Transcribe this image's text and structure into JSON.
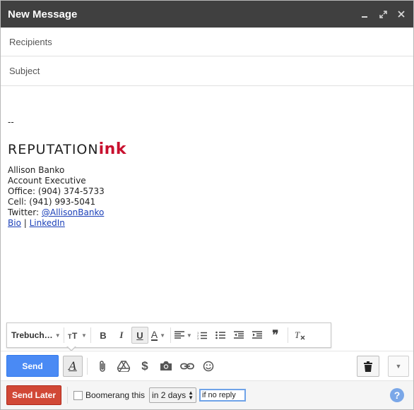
{
  "window": {
    "title": "New Message",
    "controls": {
      "minimize": "▁",
      "expand": "⤢",
      "close": "✕"
    }
  },
  "fields": {
    "recipients_placeholder": "Recipients",
    "subject_placeholder": "Subject"
  },
  "body": {
    "dashes": "--",
    "logo": {
      "part1": "REPUTATION",
      "part2": "ink"
    },
    "signature": {
      "name": "Allison Banko",
      "role": "Account Executive",
      "office": "Office: (904) 374-5733",
      "cell": "Cell: (941) 993-5041",
      "twitter_prefix": "Twitter: ",
      "twitter_handle": "@AllisonBanko",
      "bio_link": "Bio",
      "separator": " | ",
      "linkedin_link": "LinkedIn"
    }
  },
  "format_toolbar": {
    "font": "Trebuch…",
    "size_icon": "TT",
    "bold": "B",
    "italic": "I",
    "underline": "U",
    "text_color": "A",
    "quote": "❞",
    "clear": "Tx"
  },
  "actions": {
    "send_label": "Send"
  },
  "boomerang": {
    "send_later_label": "Send Later",
    "checkbox_label": "Boomerang this",
    "when_value": "in 2 days",
    "condition_value": "if no reply",
    "help_label": "?"
  },
  "colors": {
    "titlebar": "#404040",
    "send": "#4a8af4",
    "send_later": "#d14836",
    "brand_red": "#c8102e",
    "link": "#1a3fb8"
  }
}
